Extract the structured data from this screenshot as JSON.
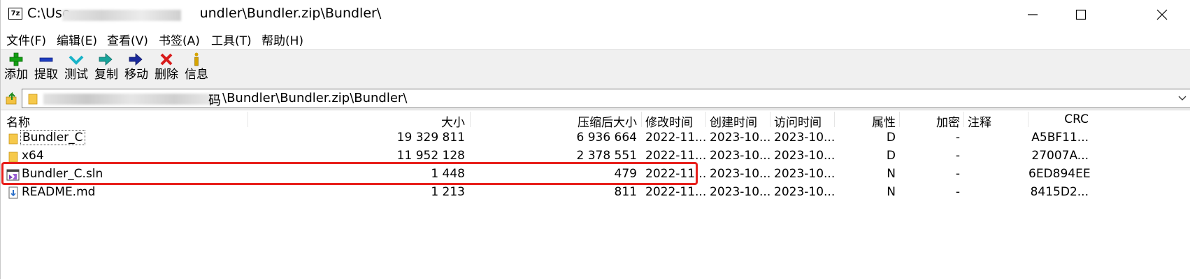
{
  "window": {
    "title": "C:\\Users\\...\\Bundler\\Bundler.zip\\Bundler\\",
    "title_prefix": "C:\\Use",
    "title_suffix": "undler\\Bundler.zip\\Bundler\\",
    "app_icon_text": "7z",
    "controls": [
      "minimize-icon",
      "maximize-icon",
      "close-icon"
    ]
  },
  "menu": [
    "文件(F)",
    "编辑(E)",
    "查看(V)",
    "书签(A)",
    "工具(T)",
    "帮助(H)"
  ],
  "toolbar": [
    {
      "label": "添加",
      "icon": "add-icon",
      "color": "#13a013"
    },
    {
      "label": "提取",
      "icon": "extract-icon",
      "color": "#1f3fbf"
    },
    {
      "label": "测试",
      "icon": "test-icon",
      "color": "#19b3c8"
    },
    {
      "label": "复制",
      "icon": "copy-icon",
      "color": "#19a39a"
    },
    {
      "label": "移动",
      "icon": "move-icon",
      "color": "#1a2a9c"
    },
    {
      "label": "删除",
      "icon": "delete-icon",
      "color": "#d81b1b"
    },
    {
      "label": "信息",
      "icon": "info-icon",
      "color": "#d6a400"
    }
  ],
  "address": {
    "visible_text": "\\Bundler\\Bundler.zip\\Bundler\\",
    "prefix_partial": "C",
    "suffix_partial_char": "码"
  },
  "columns": [
    "名称",
    "大小",
    "压缩后大小",
    "修改时间",
    "创建时间",
    "访问时间",
    "属性",
    "加密",
    "注释",
    "CRC"
  ],
  "rows": [
    {
      "name": "Bundler_C",
      "type": "folder",
      "size": "19 329 811",
      "packed": "6 936 664",
      "modified": "2022-11...",
      "created": "2023-10...",
      "accessed": "2023-10...",
      "attr": "D",
      "encrypted": "-",
      "comment": "",
      "crc": "A5BF11..."
    },
    {
      "name": "x64",
      "type": "folder",
      "size": "11 952 128",
      "packed": "2 378 551",
      "modified": "2022-11...",
      "created": "2023-10...",
      "accessed": "2023-10...",
      "attr": "D",
      "encrypted": "-",
      "comment": "",
      "crc": "27007A..."
    },
    {
      "name": "Bundler_C.sln",
      "type": "sln",
      "size": "1 448",
      "packed": "479",
      "modified": "2022-11...",
      "created": "2023-10...",
      "accessed": "2023-10...",
      "attr": "N",
      "encrypted": "-",
      "comment": "",
      "crc": "6ED894EE"
    },
    {
      "name": "README.md",
      "type": "md",
      "size": "1 213",
      "packed": "811",
      "modified": "2022-11...",
      "created": "2023-10...",
      "accessed": "2023-10...",
      "attr": "N",
      "encrypted": "-",
      "comment": "",
      "crc": "8415D2..."
    }
  ],
  "highlight_color": "#e8201c"
}
